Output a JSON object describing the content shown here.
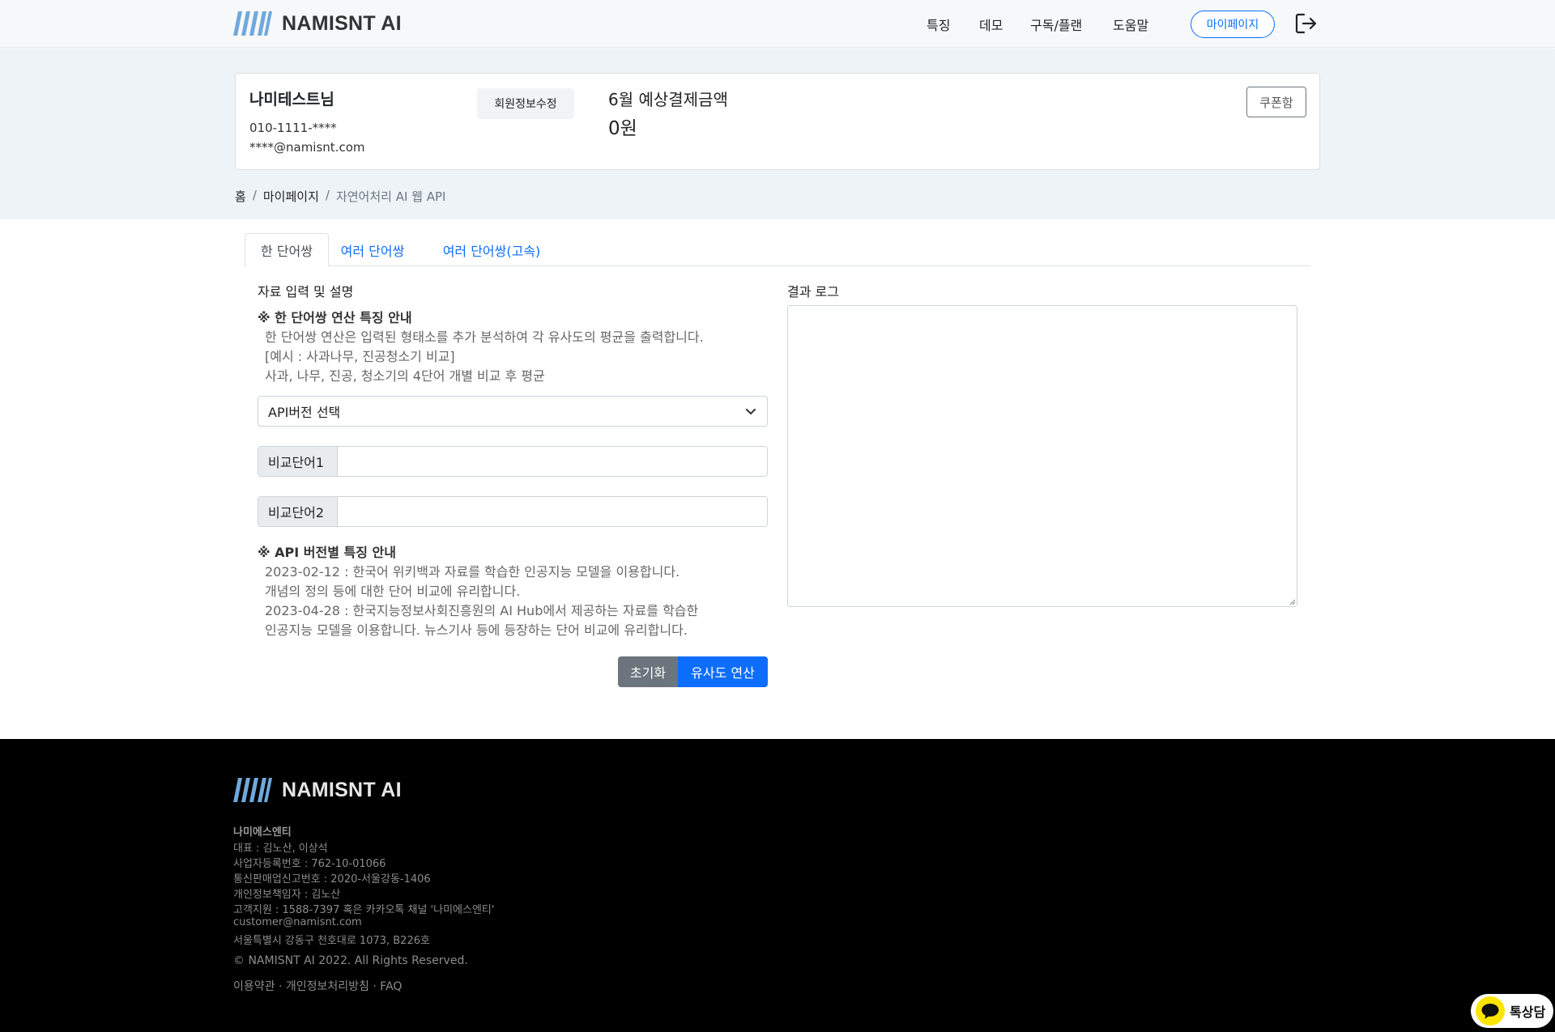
{
  "brand": {
    "name": "NAMISNT AI"
  },
  "nav": {
    "items": [
      "특징",
      "데모",
      "구독/플랜",
      "도움말"
    ],
    "mypage_label": "마이페이지"
  },
  "profile": {
    "name": "나미테스트님",
    "phone": "010-1111-****",
    "email": "****@namisnt.com",
    "edit_label": "회원정보수정",
    "payment_label": "6월 예상결제금액",
    "payment_amount": "0원",
    "coupon_label": "쿠폰함"
  },
  "breadcrumb": {
    "home": "홈",
    "mypage": "마이페이지",
    "current": "자연어처리 AI 웹 API"
  },
  "tabs": [
    "한 단어쌍",
    "여러 단어쌍",
    "여러 단어쌍(고속)"
  ],
  "left": {
    "section_title": "자료 입력 및 설명",
    "notice1_title": "※ 한 단어쌍 연산 특징 안내",
    "notice1_lines": [
      "한 단어쌍 연산은 입력된 형태소를 추가 분석하여 각 유사도의 평균을 출력합니다.",
      "[예시 : 사과나무, 진공청소기 비교]",
      "사과, 나무, 진공, 청소기의 4단어 개별 비교 후 평균"
    ],
    "select_value": "API버전 선택",
    "word1_label": "비교단어1",
    "word1_value": "",
    "word2_label": "비교단어2",
    "word2_value": "",
    "notice2_title": "※ API 버전별 특징 안내",
    "notice2_lines": [
      "2023-02-12 : 한국어 위키백과 자료를 학습한 인공지능 모델을 이용합니다.",
      "개념의 정의 등에 대한 단어 비교에 유리합니다.",
      "2023-04-28 : 한국지능정보사회진흥원의 AI Hub에서 제공하는 자료를 학습한",
      "인공지능 모델을 이용합니다. 뉴스기사 등에 등장하는 단어 비교에 유리합니다."
    ],
    "reset_label": "초기화",
    "run_label": "유사도 연산"
  },
  "right": {
    "log_title": "결과 로그",
    "log_value": ""
  },
  "footer": {
    "company": "나미에스엔티",
    "lines": [
      "대표 : 김노산, 이상석",
      "사업자등록번호 : 762-10-01066",
      "통신판매업신고번호 : 2020-서울강동-1406",
      "개인정보책임자 : 김노산",
      "고객지원 : 1588-7397 혹은 카카오톡 채널 '나미에스엔티'",
      "customer@namisnt.com",
      "서울특별시 강동구 천호대로 1073, B226호"
    ],
    "copyright": "© NAMISNT AI 2022. All Rights Reserved.",
    "links": [
      "이용약관",
      "개인정보처리방침",
      "FAQ"
    ],
    "link_separator": "·"
  },
  "kakao": {
    "label": "톡상담"
  },
  "colors": {
    "primary": "#0d6efd",
    "secondary": "#6c757d",
    "band": "#eef3f7",
    "logo_blue": "#6fa8dc",
    "footer_bg": "#000000",
    "kakao_yellow": "#fee500"
  }
}
